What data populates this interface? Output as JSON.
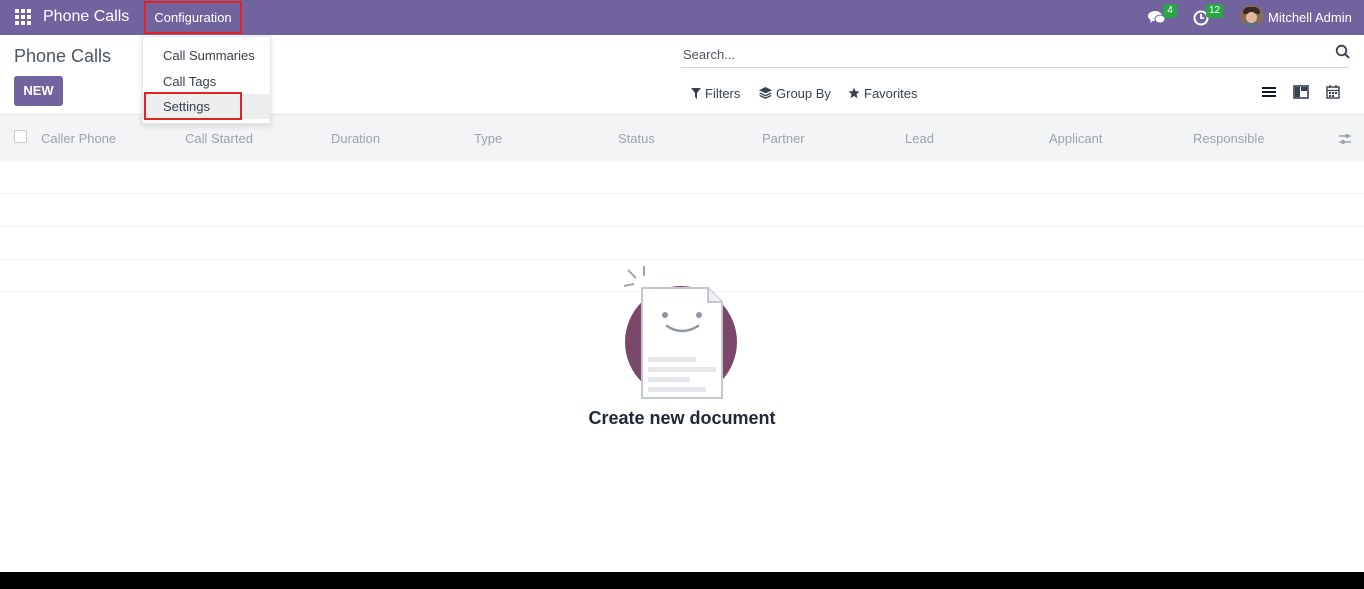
{
  "navbar": {
    "app_name": "Phone Calls",
    "menu_configuration": "Configuration",
    "messages_count": "4",
    "activities_count": "12",
    "user_name": "Mitchell Admin",
    "color": "#71639e"
  },
  "control_panel": {
    "title": "Phone Calls",
    "new_button": "NEW",
    "search_placeholder": "Search...",
    "filters_label": "Filters",
    "group_by_label": "Group By",
    "favorites_label": "Favorites",
    "views": [
      "list-icon",
      "kanban-icon",
      "calendar-icon"
    ]
  },
  "list": {
    "columns": [
      "Caller Phone",
      "Call Started",
      "Duration",
      "Type",
      "Status",
      "Partner",
      "Lead",
      "Applicant",
      "Responsible"
    ]
  },
  "empty_state": {
    "title": "Create new document"
  },
  "config_menu": {
    "items": [
      "Call Summaries",
      "Call Tags",
      "Settings"
    ],
    "highlighted_item": "Settings"
  },
  "colors": {
    "primary": "#71639e",
    "badge": "#28a745",
    "highlight_border": "#e02424"
  }
}
